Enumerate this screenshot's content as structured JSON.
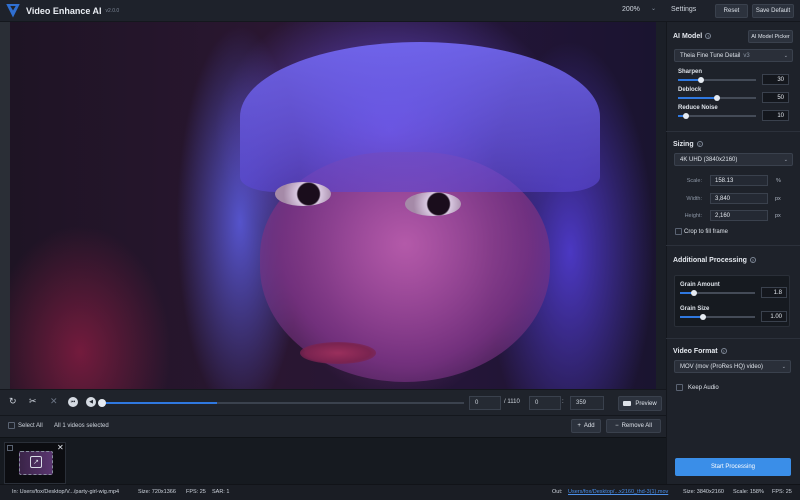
{
  "titlebar": {
    "app_title": "Video Enhance AI",
    "version": "v2.0.0",
    "zoom": "200%",
    "zoom_chevron": "⌄",
    "settings_label": "Settings",
    "reset_label": "Reset",
    "save_default_label": "Save Default"
  },
  "playback": {
    "loop_icon": "↻",
    "scissors_icon": "✂",
    "cut_icon": "✕",
    "prev_icon": "⏮",
    "play_icon": "◀",
    "current_frame": "0",
    "total_frames": "/ 1110",
    "range_start": "0",
    "range_end": "359",
    "progress": 0.32,
    "preview_label": "Preview",
    "colon": ":"
  },
  "selection": {
    "select_all_label": "Select All",
    "count_text": "All 1 videos selected",
    "add_label": "Add",
    "remove_all_label": "Remove All",
    "add_icon": "+",
    "remove_icon": "−"
  },
  "thumbnail": {
    "open_icon": "↗",
    "close_icon": "✕"
  },
  "statusbar": {
    "in_path": "In: Users/fox/Desktop/V.../party-girl-wig.mp4",
    "in_size": "Size: 720x1366",
    "in_fps": "FPS: 25",
    "in_sar": "SAR: 1",
    "out_label": "Out:",
    "out_path": "Users/fox/Desktop/...x2160_thd-3(1).mov",
    "out_size": "Size: 3840x2160",
    "out_scale": "Scale: 158%",
    "out_fps": "FPS: 25"
  },
  "ai_model": {
    "title": "AI Model",
    "help": "?",
    "picker_label": "AI Model Picker",
    "model_name": "Theia Fine Tune Detail",
    "model_version": "v3",
    "params": [
      {
        "label": "Sharpen",
        "value": "30",
        "fraction": 0.3
      },
      {
        "label": "Deblock",
        "value": "50",
        "fraction": 0.5
      },
      {
        "label": "Reduce Noise",
        "value": "10",
        "fraction": 0.1
      }
    ]
  },
  "sizing": {
    "title": "Sizing",
    "help": "?",
    "preset": "4K UHD (3840x2160)",
    "scale_label": "Scale:",
    "scale_value": "158.13",
    "scale_unit": "%",
    "width_label": "Width:",
    "width_value": "3,840",
    "width_unit": "px",
    "height_label": "Height:",
    "height_value": "2,160",
    "height_unit": "px",
    "crop_label": "Crop to fill frame"
  },
  "additional": {
    "title": "Additional Processing",
    "help": "?",
    "grain_amount_label": "Grain Amount",
    "grain_amount_value": "1.8",
    "grain_amount_fraction": 0.18,
    "grain_size_label": "Grain Size",
    "grain_size_value": "1.00",
    "grain_size_fraction": 0.3
  },
  "video_format": {
    "title": "Video Format",
    "help": "?",
    "format": "MOV (mov (ProRes HQ) video)",
    "keep_audio_label": "Keep Audio"
  },
  "start_label": "Start Processing",
  "colors": {
    "accent": "#2f78e0",
    "start_button": "#3a8ee8",
    "link": "#4b8fe8"
  }
}
